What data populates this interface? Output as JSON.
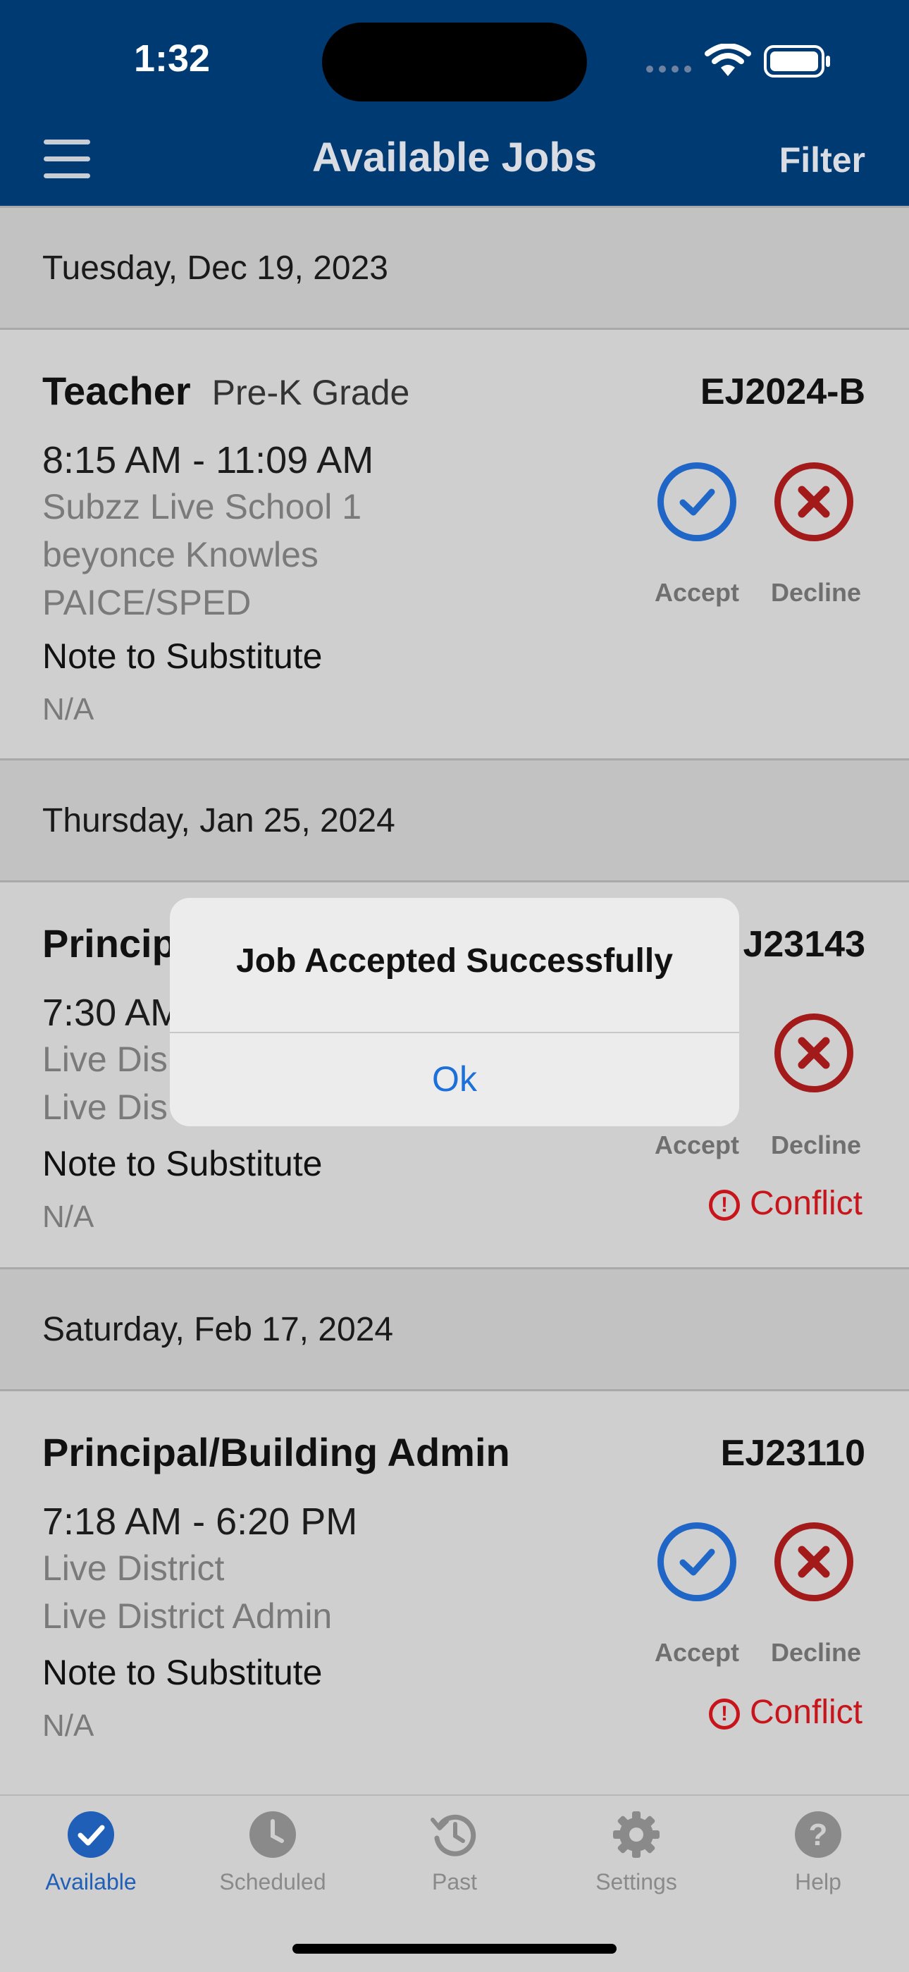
{
  "status_bar": {
    "time": "1:32"
  },
  "nav": {
    "title": "Available Jobs",
    "filter_label": "Filter"
  },
  "sections": [
    {
      "date": "Tuesday, Dec 19, 2023",
      "job": {
        "title": "Teacher",
        "subtitle": "Pre-K Grade",
        "id": "EJ2024-B",
        "time": "8:15 AM - 11:09 AM",
        "details": [
          "Subzz Live School 1",
          "beyonce Knowles",
          "PAICE/SPED"
        ],
        "note_label": "Note to Substitute",
        "note_value": "N/A",
        "accept_label": "Accept",
        "decline_label": "Decline"
      }
    },
    {
      "date": "Thursday, Jan 25, 2024",
      "job": {
        "title": "Princip",
        "id": "J23143",
        "time": "7:30 AM",
        "details": [
          "Live Dis",
          "Live Dis"
        ],
        "note_label": "Note to Substitute",
        "note_value": "N/A",
        "accept_label": "Accept",
        "decline_label": "Decline",
        "conflict_label": "Conflict"
      }
    },
    {
      "date": "Saturday, Feb 17, 2024",
      "job": {
        "title": "Principal/Building Admin",
        "id": "EJ23110",
        "time": "7:18 AM - 6:20 PM",
        "details": [
          "Live District",
          "Live District Admin"
        ],
        "note_label": "Note to Substitute",
        "note_value": "N/A",
        "accept_label": "Accept",
        "decline_label": "Decline",
        "conflict_label": "Conflict"
      }
    }
  ],
  "dialog": {
    "title": "Job Accepted Successfully",
    "ok_label": "Ok"
  },
  "tabs": [
    {
      "label": "Available",
      "icon": "check-circle-icon",
      "active": true
    },
    {
      "label": "Scheduled",
      "icon": "clock-icon",
      "active": false
    },
    {
      "label": "Past",
      "icon": "history-icon",
      "active": false
    },
    {
      "label": "Settings",
      "icon": "gear-icon",
      "active": false
    },
    {
      "label": "Help",
      "icon": "help-icon",
      "active": false
    }
  ],
  "colors": {
    "nav_bg": "#003a73",
    "accept": "#1f66c7",
    "decline": "#a31a1a",
    "conflict": "#c8151b",
    "active_tab": "#1f5fb8"
  }
}
